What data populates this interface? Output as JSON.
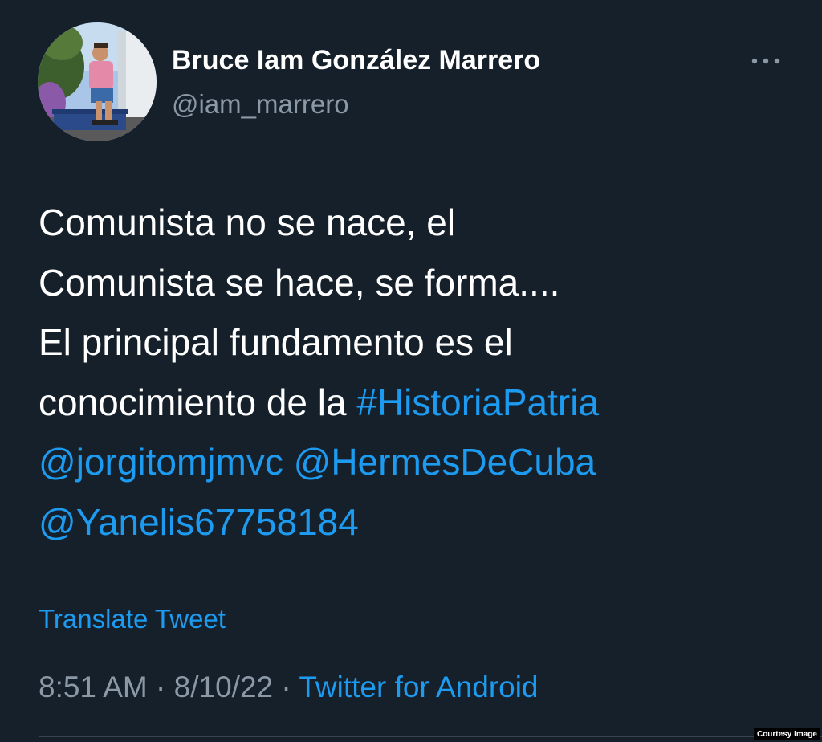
{
  "author": {
    "display_name": "Bruce Iam González Marrero",
    "handle": "@iam_marrero",
    "avatar_icon": "profile-photo"
  },
  "more_icon": "more-horizontal-icon",
  "tweet": {
    "lines": [
      {
        "text": "Comunista no se nace, el"
      },
      {
        "text": "Comunista se hace, se forma...."
      },
      {
        "text": "El principal fundamento es el"
      },
      {
        "prefix": "conocimiento de la ",
        "hashtag": "#HistoriaPatria"
      },
      {
        "mention1": "@jorgitomjmvc",
        "mention2": "@HermesDeCuba"
      },
      {
        "mention3": "@Yanelis67758184"
      }
    ]
  },
  "translate_label": "Translate Tweet",
  "meta": {
    "time": "8:51 AM",
    "separator": " · ",
    "date": "8/10/22",
    "source": "Twitter for Android"
  },
  "courtesy_label": "Courtesy Image",
  "colors": {
    "background": "#15202b",
    "primary_text": "#ffffff",
    "secondary_text": "#8b98a5",
    "link": "#1d9bf0"
  }
}
